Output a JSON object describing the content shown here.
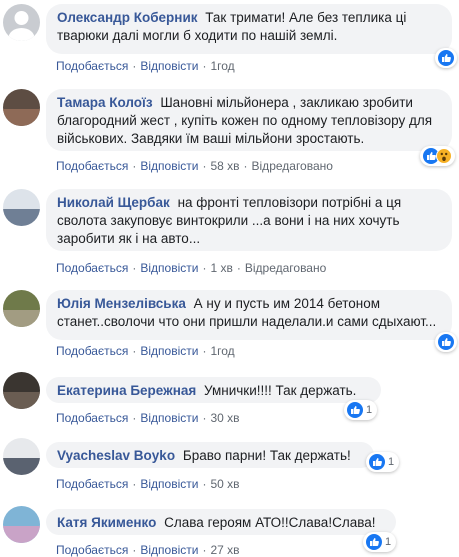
{
  "labels": {
    "like": "Подобається",
    "reply": "Відповісти",
    "edited": "Відредаговано"
  },
  "colors": {
    "link": "#385898",
    "bubble": "#f2f3f5",
    "like": "#1877f2",
    "wow": "#f7b125"
  },
  "comments": [
    {
      "author": "Олександр Коберник",
      "text": "Так тримати! Але без теплика ці тварюки далі могли б ходити по нашій землі.",
      "time": "1год",
      "edited": false,
      "reactions": [
        "like-icon"
      ],
      "count": ""
    },
    {
      "author": "Тамара Колоїз",
      "text": "Шановні мільйонера , закликаю зробити благородний жест , купіть кожен по одному тепловізору для військових. Завдяки їм ваші мільйони зростають.",
      "time": "58 хв",
      "edited": true,
      "reactions": [
        "like-icon",
        "wow-icon"
      ],
      "count": ""
    },
    {
      "author": "Николай Щербак",
      "text": "на фронті тепловізори потрібні а ця сволота закуповує винтокрили ...а вони і на них хочуть заробити як і на авто...",
      "time": "1 хв",
      "edited": true,
      "reactions": [],
      "count": ""
    },
    {
      "author": "Юлія Мензелівська",
      "text": "А ну и пусть им 2014 бетоном станет..сволочи что они пришли наделали.и сами сдыхают...",
      "time": "1год",
      "edited": false,
      "reactions": [
        "like-icon"
      ],
      "count": ""
    },
    {
      "author": "Екатерина Бережная",
      "text": "Умнички!!!! Так держать.",
      "time": "30 хв",
      "edited": false,
      "reactions": [
        "like-icon"
      ],
      "count": "1"
    },
    {
      "author": "Vyacheslav Boyko",
      "text": "Браво парни! Так держать!",
      "time": "50 хв",
      "edited": false,
      "reactions": [
        "like-icon"
      ],
      "count": "1"
    },
    {
      "author": "Катя Якименко",
      "text": "Слава героям АТО!!Слава!Слава!",
      "time": "27 хв",
      "edited": false,
      "reactions": [
        "like-icon"
      ],
      "count": "1"
    }
  ]
}
